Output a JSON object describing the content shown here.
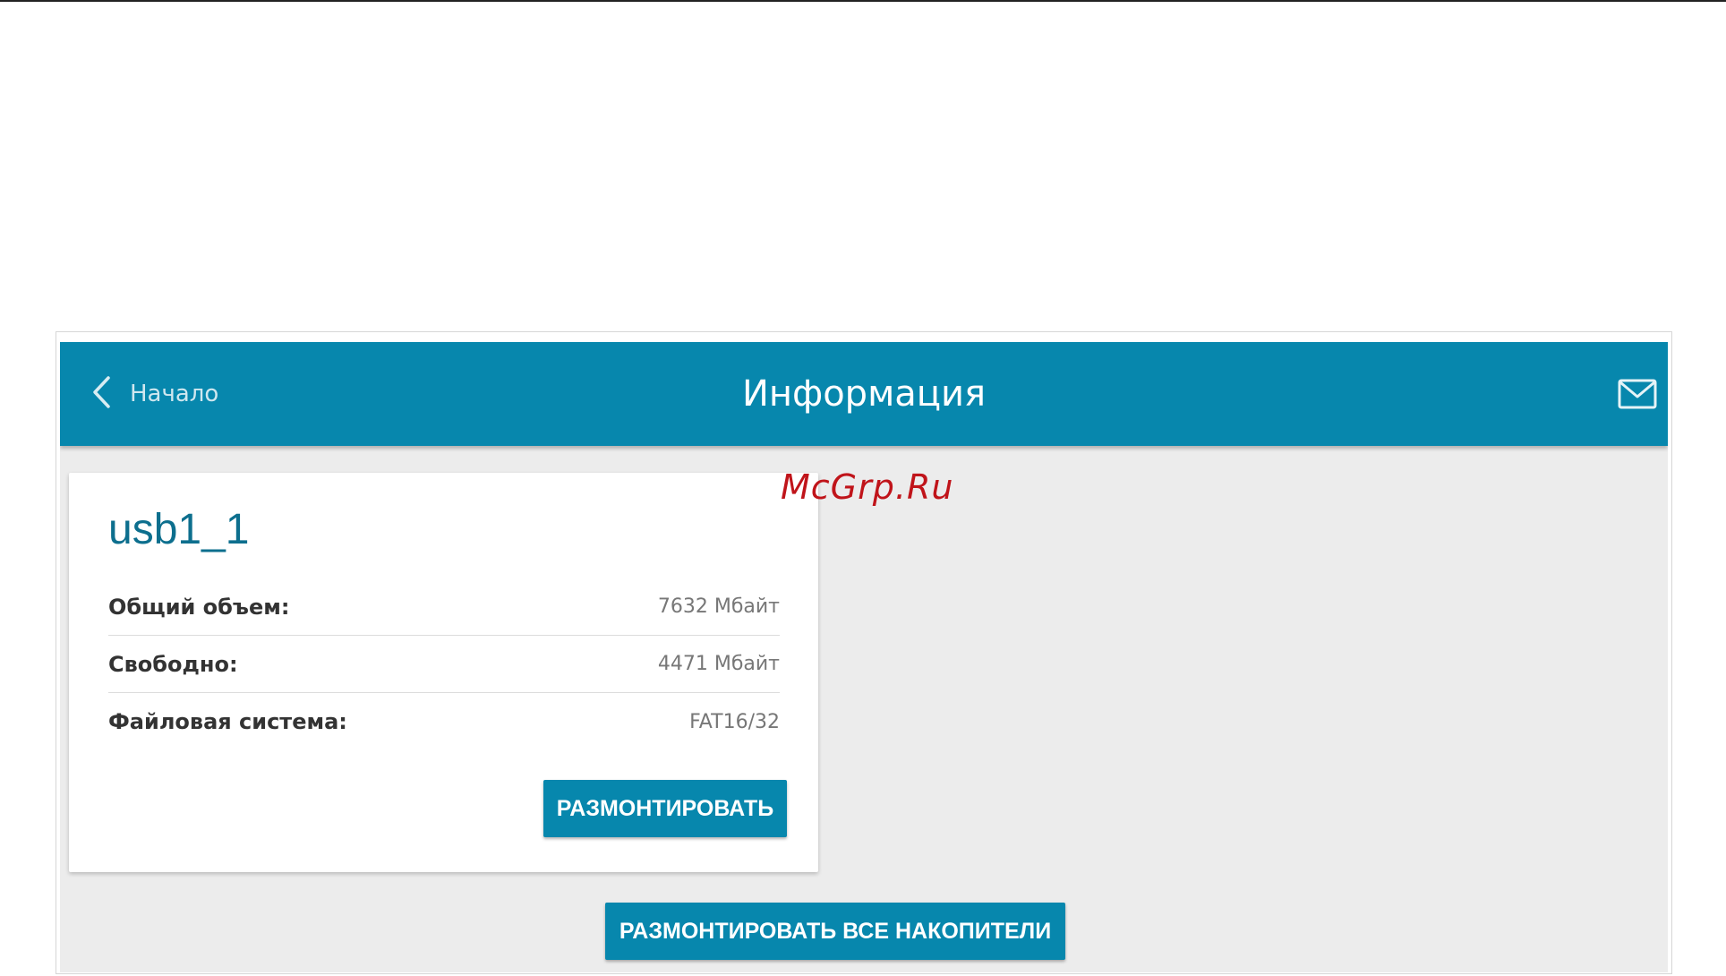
{
  "header": {
    "back_label": "Начало",
    "title": "Информация",
    "accent_color": "#0787ad"
  },
  "device": {
    "name": "usb1_1",
    "rows": [
      {
        "label": "Общий объем:",
        "value": "7632 Мбайт"
      },
      {
        "label": "Свободно:",
        "value": "4471 Мбайт"
      },
      {
        "label": "Файловая система:",
        "value": "FAT16/32"
      }
    ],
    "unmount_label": "РАЗМОНТИРОВАТЬ"
  },
  "footer": {
    "unmount_all_label": "РАЗМОНТИРОВАТЬ ВСЕ НАКОПИТЕЛИ"
  },
  "watermark": "McGrp.Ru",
  "icons": {
    "back": "chevron-left-icon",
    "mail": "mail-icon"
  }
}
